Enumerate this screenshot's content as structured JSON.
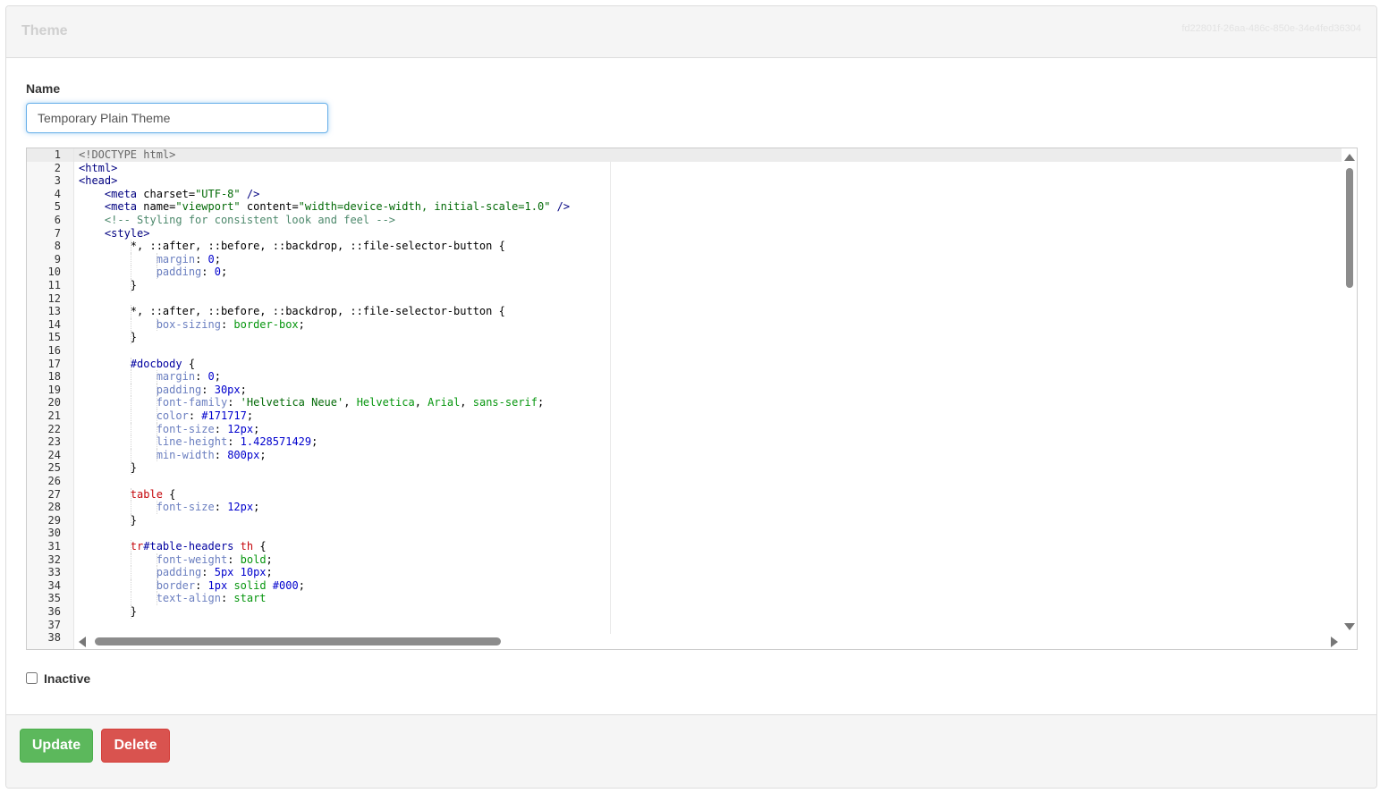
{
  "header": {
    "title": "Theme",
    "record_id": "fd22801f-26aa-486c-850e-34e4fed36304"
  },
  "form": {
    "name_label": "Name",
    "name_value": "Temporary Plain Theme",
    "inactive_label": "Inactive",
    "inactive_checked": false
  },
  "editor": {
    "first_line": 1,
    "active_line": 1,
    "scroll": {
      "vertical_position": 0.0,
      "horizontal_position": 0.0
    },
    "lines": [
      [
        [
          "t-doctype",
          "<!DOCTYPE html>"
        ]
      ],
      [
        [
          "t-tag",
          "<html>"
        ]
      ],
      [
        [
          "t-tag",
          "<head>"
        ]
      ],
      [
        [
          "",
          "    "
        ],
        [
          "t-tag",
          "<meta "
        ],
        [
          "t-attr",
          "charset="
        ],
        [
          "t-str",
          "\"UTF-8\""
        ],
        [
          "t-tag",
          " />"
        ]
      ],
      [
        [
          "",
          "    "
        ],
        [
          "t-tag",
          "<meta "
        ],
        [
          "t-attr",
          "name="
        ],
        [
          "t-str",
          "\"viewport\""
        ],
        [
          "t-attr",
          " content="
        ],
        [
          "t-str",
          "\"width=device-width, initial-scale=1.0\""
        ],
        [
          "t-tag",
          " />"
        ]
      ],
      [
        [
          "",
          "    "
        ],
        [
          "t-comment",
          "<!-- Styling for consistent look and feel -->"
        ]
      ],
      [
        [
          "",
          "    "
        ],
        [
          "t-tag",
          "<style>"
        ]
      ],
      [
        [
          "",
          "        "
        ],
        [
          "t-attr",
          "*, ::after, ::before, ::backdrop, ::file-selector-button {"
        ]
      ],
      [
        [
          "",
          "            "
        ],
        [
          "t-prop",
          "margin"
        ],
        [
          "t-attr",
          ": "
        ],
        [
          "t-num",
          "0"
        ],
        [
          "t-attr",
          ";"
        ]
      ],
      [
        [
          "",
          "            "
        ],
        [
          "t-prop",
          "padding"
        ],
        [
          "t-attr",
          ": "
        ],
        [
          "t-num",
          "0"
        ],
        [
          "t-attr",
          ";"
        ]
      ],
      [
        [
          "",
          "        "
        ],
        [
          "t-attr",
          "}"
        ]
      ],
      [
        [
          "",
          ""
        ]
      ],
      [
        [
          "",
          "        "
        ],
        [
          "t-attr",
          "*, ::after, ::before, ::backdrop, ::file-selector-button {"
        ]
      ],
      [
        [
          "",
          "            "
        ],
        [
          "t-prop",
          "box-sizing"
        ],
        [
          "t-attr",
          ": "
        ],
        [
          "t-val",
          "border-box"
        ],
        [
          "t-attr",
          ";"
        ]
      ],
      [
        [
          "",
          "        "
        ],
        [
          "t-attr",
          "}"
        ]
      ],
      [
        [
          "",
          ""
        ]
      ],
      [
        [
          "",
          "        "
        ],
        [
          "t-sel",
          "#docbody"
        ],
        [
          "t-attr",
          " {"
        ]
      ],
      [
        [
          "",
          "            "
        ],
        [
          "t-prop",
          "margin"
        ],
        [
          "t-attr",
          ": "
        ],
        [
          "t-num",
          "0"
        ],
        [
          "t-attr",
          ";"
        ]
      ],
      [
        [
          "",
          "            "
        ],
        [
          "t-prop",
          "padding"
        ],
        [
          "t-attr",
          ": "
        ],
        [
          "t-num",
          "30px"
        ],
        [
          "t-attr",
          ";"
        ]
      ],
      [
        [
          "",
          "            "
        ],
        [
          "t-prop",
          "font-family"
        ],
        [
          "t-attr",
          ": "
        ],
        [
          "t-str",
          "'Helvetica Neue'"
        ],
        [
          "t-attr",
          ", "
        ],
        [
          "t-val",
          "Helvetica"
        ],
        [
          "t-attr",
          ", "
        ],
        [
          "t-val",
          "Arial"
        ],
        [
          "t-attr",
          ", "
        ],
        [
          "t-val",
          "sans-serif"
        ],
        [
          "t-attr",
          ";"
        ]
      ],
      [
        [
          "",
          "            "
        ],
        [
          "t-prop",
          "color"
        ],
        [
          "t-attr",
          ": "
        ],
        [
          "t-num",
          "#171717"
        ],
        [
          "t-attr",
          ";"
        ]
      ],
      [
        [
          "",
          "            "
        ],
        [
          "t-prop",
          "font-size"
        ],
        [
          "t-attr",
          ": "
        ],
        [
          "t-num",
          "12px"
        ],
        [
          "t-attr",
          ";"
        ]
      ],
      [
        [
          "",
          "            "
        ],
        [
          "t-prop",
          "line-height"
        ],
        [
          "t-attr",
          ": "
        ],
        [
          "t-num",
          "1.428571429"
        ],
        [
          "t-attr",
          ";"
        ]
      ],
      [
        [
          "",
          "            "
        ],
        [
          "t-prop",
          "min-width"
        ],
        [
          "t-attr",
          ": "
        ],
        [
          "t-num",
          "800px"
        ],
        [
          "t-attr",
          ";"
        ]
      ],
      [
        [
          "",
          "        "
        ],
        [
          "t-attr",
          "}"
        ]
      ],
      [
        [
          "",
          ""
        ]
      ],
      [
        [
          "",
          "        "
        ],
        [
          "t-kw",
          "table"
        ],
        [
          "t-attr",
          " {"
        ]
      ],
      [
        [
          "",
          "            "
        ],
        [
          "t-prop",
          "font-size"
        ],
        [
          "t-attr",
          ": "
        ],
        [
          "t-num",
          "12px"
        ],
        [
          "t-attr",
          ";"
        ]
      ],
      [
        [
          "",
          "        "
        ],
        [
          "t-attr",
          "}"
        ]
      ],
      [
        [
          "",
          ""
        ]
      ],
      [
        [
          "",
          "        "
        ],
        [
          "t-kw",
          "tr"
        ],
        [
          "t-sel",
          "#table-headers"
        ],
        [
          "t-attr",
          " "
        ],
        [
          "t-kw",
          "th"
        ],
        [
          "t-attr",
          " {"
        ]
      ],
      [
        [
          "",
          "            "
        ],
        [
          "t-prop",
          "font-weight"
        ],
        [
          "t-attr",
          ": "
        ],
        [
          "t-val",
          "bold"
        ],
        [
          "t-attr",
          ";"
        ]
      ],
      [
        [
          "",
          "            "
        ],
        [
          "t-prop",
          "padding"
        ],
        [
          "t-attr",
          ": "
        ],
        [
          "t-num",
          "5px 10px"
        ],
        [
          "t-attr",
          ";"
        ]
      ],
      [
        [
          "",
          "            "
        ],
        [
          "t-prop",
          "border"
        ],
        [
          "t-attr",
          ": "
        ],
        [
          "t-num",
          "1px"
        ],
        [
          "t-attr",
          " "
        ],
        [
          "t-val",
          "solid"
        ],
        [
          "t-attr",
          " "
        ],
        [
          "t-num",
          "#000"
        ],
        [
          "t-attr",
          ";"
        ]
      ],
      [
        [
          "",
          "            "
        ],
        [
          "t-prop",
          "text-align"
        ],
        [
          "t-attr",
          ": "
        ],
        [
          "t-val",
          "start"
        ]
      ],
      [
        [
          "",
          "        "
        ],
        [
          "t-attr",
          "}"
        ]
      ],
      [
        [
          "",
          ""
        ]
      ],
      [
        [
          "",
          ""
        ]
      ]
    ]
  },
  "actions": {
    "update_label": "Update",
    "delete_label": "Delete"
  },
  "colors": {
    "update": "#5cb85c",
    "delete": "#d9534f",
    "focus_border": "#66afe9"
  }
}
